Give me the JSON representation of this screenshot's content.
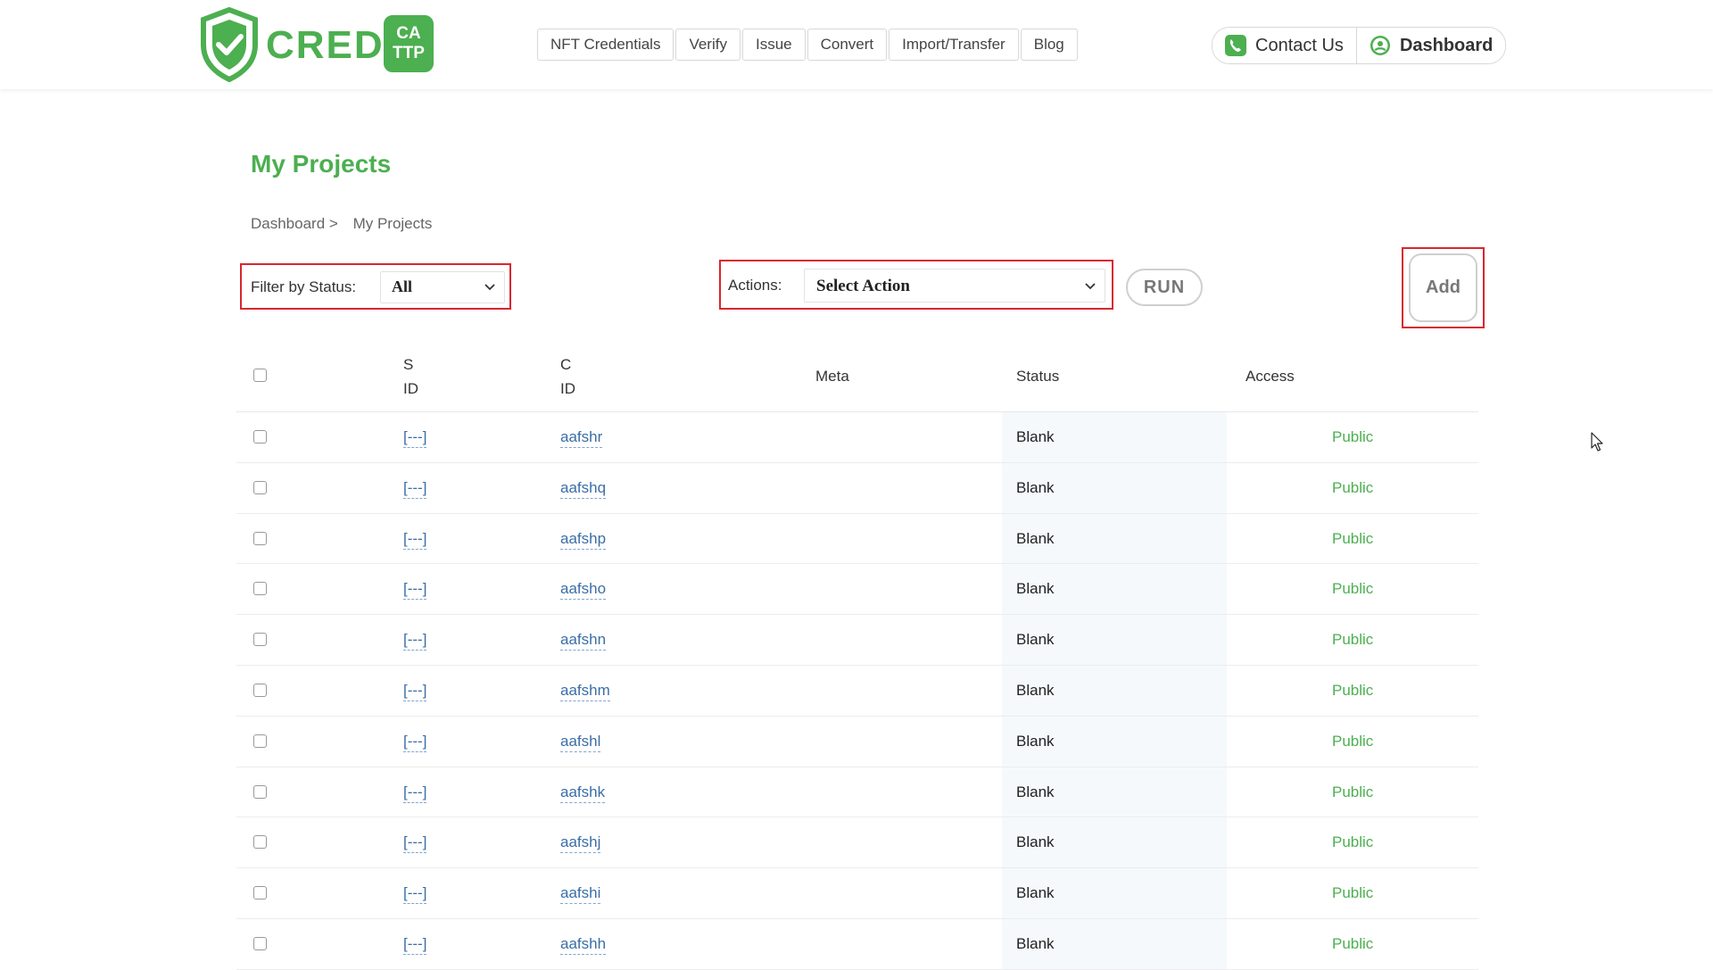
{
  "brand": {
    "name": "CREDLY",
    "badge_line1": "CA",
    "badge_line2": "TTP",
    "color": "#4caf50"
  },
  "nav": [
    {
      "label": "NFT Credentials"
    },
    {
      "label": "Verify"
    },
    {
      "label": "Issue"
    },
    {
      "label": "Convert"
    },
    {
      "label": "Import/Transfer"
    },
    {
      "label": "Blog"
    }
  ],
  "header_right": {
    "contact_label": "Contact Us",
    "contact_icon": "phone-icon",
    "dashboard_label": "Dashboard",
    "dashboard_icon": "user-icon"
  },
  "page": {
    "title": "My Projects",
    "breadcrumb": [
      "Dashboard >",
      "My Projects"
    ]
  },
  "filter": {
    "label": "Filter by Status:",
    "value": "All"
  },
  "actions": {
    "label": "Actions:",
    "value": "Select Action",
    "run_label": "RUN"
  },
  "add_label": "Add",
  "table": {
    "headers": {
      "s_id_line1": "S",
      "s_id_line2": "ID",
      "c_id_line1": "C",
      "c_id_line2": "ID",
      "meta": "Meta",
      "status": "Status",
      "access": "Access"
    },
    "rows": [
      {
        "sid": "[---]",
        "cid": "aafshr",
        "meta": "",
        "status": "Blank",
        "access": "Public"
      },
      {
        "sid": "[---]",
        "cid": "aafshq",
        "meta": "",
        "status": "Blank",
        "access": "Public"
      },
      {
        "sid": "[---]",
        "cid": "aafshp",
        "meta": "",
        "status": "Blank",
        "access": "Public"
      },
      {
        "sid": "[---]",
        "cid": "aafsho",
        "meta": "",
        "status": "Blank",
        "access": "Public"
      },
      {
        "sid": "[---]",
        "cid": "aafshn",
        "meta": "",
        "status": "Blank",
        "access": "Public"
      },
      {
        "sid": "[---]",
        "cid": "aafshm",
        "meta": "",
        "status": "Blank",
        "access": "Public"
      },
      {
        "sid": "[---]",
        "cid": "aafshl",
        "meta": "",
        "status": "Blank",
        "access": "Public"
      },
      {
        "sid": "[---]",
        "cid": "aafshk",
        "meta": "",
        "status": "Blank",
        "access": "Public"
      },
      {
        "sid": "[---]",
        "cid": "aafshj",
        "meta": "",
        "status": "Blank",
        "access": "Public"
      },
      {
        "sid": "[---]",
        "cid": "aafshi",
        "meta": "",
        "status": "Blank",
        "access": "Public"
      },
      {
        "sid": "[---]",
        "cid": "aafshh",
        "meta": "",
        "status": "Blank",
        "access": "Public"
      }
    ]
  }
}
